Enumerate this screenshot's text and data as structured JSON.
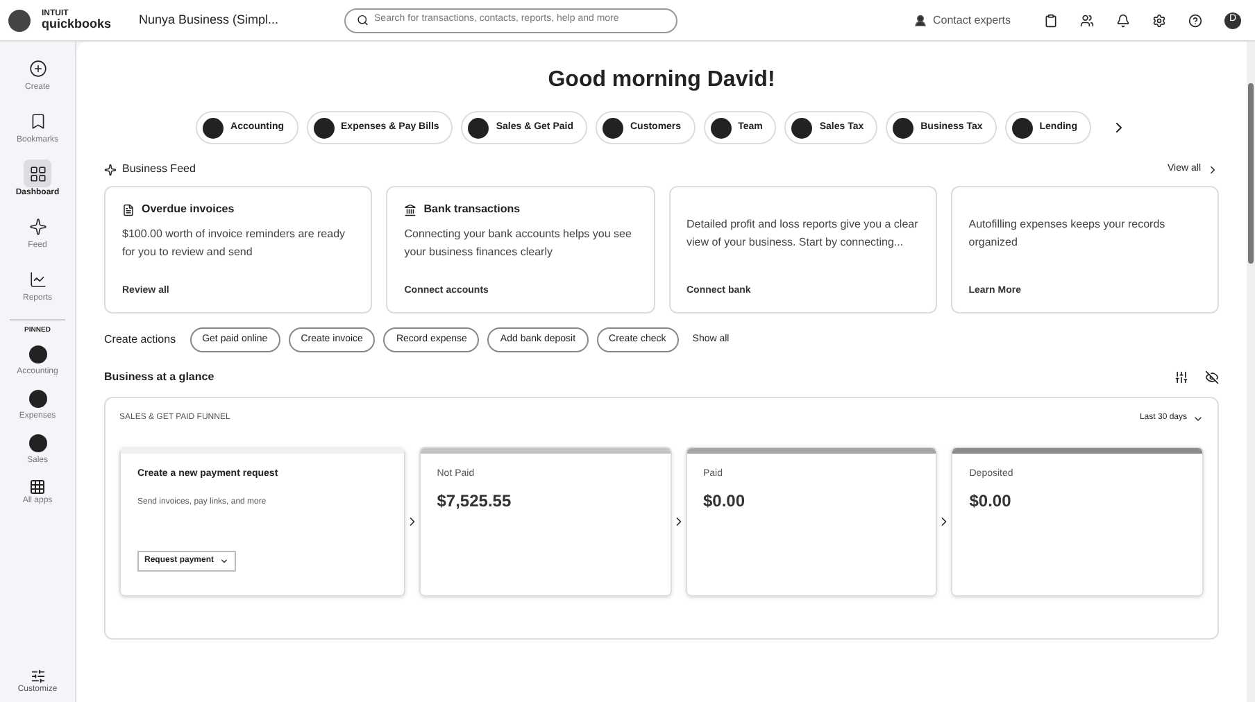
{
  "topbar": {
    "logo_top": "INTUIT",
    "logo_bottom": "quickbooks",
    "company": "Nunya Business (Simpl...",
    "search": {
      "placeholder": "Search for transactions, contacts, reports, help and more"
    },
    "contact": "Contact experts",
    "avatar": "D"
  },
  "sidebar": {
    "items": [
      {
        "label": "Create",
        "selected": false
      },
      {
        "label": "Bookmarks",
        "selected": false
      },
      {
        "label": "Dashboard",
        "selected": true
      },
      {
        "label": "Feed",
        "selected": false
      },
      {
        "label": "Reports",
        "selected": false
      }
    ],
    "section": "PINNED",
    "pinned": [
      {
        "label": "Accounting",
        "selected": false
      },
      {
        "label": "Expenses",
        "selected": false
      },
      {
        "label": "Sales",
        "selected": false
      }
    ],
    "apps": "All apps",
    "customize": "Customize"
  },
  "greeting": "Good morning David!",
  "chips": [
    "Accounting",
    "Expenses & Pay Bills",
    "Sales & Get Paid",
    "Customers",
    "Team",
    "Sales Tax",
    "Business Tax",
    "Lending"
  ],
  "feed": {
    "title": "Business Feed",
    "view_all": "View all",
    "cards": [
      {
        "title": "Overdue invoices",
        "text": "$100.00 worth of invoice reminders are ready for you to review and send",
        "link": "Review all"
      },
      {
        "title": "Bank transactions",
        "text": "Connecting your bank accounts helps you see your business finances clearly",
        "link": "Connect accounts"
      },
      {
        "text": "Detailed profit and loss reports give you a clear view of your business. Start by connecting...",
        "link": "Connect bank"
      },
      {
        "text": "Autofilling expenses keeps your records organized",
        "link": "Learn More"
      }
    ]
  },
  "actions": {
    "label": "Create actions",
    "buttons": [
      "Get paid online",
      "Create invoice",
      "Record expense",
      "Add bank deposit",
      "Create check"
    ],
    "show_all": "Show all"
  },
  "glance": {
    "title": "Business at a glance"
  },
  "funnel": {
    "title": "SALES & GET PAID FUNNEL",
    "range": "Last 30 days",
    "cards": [
      {
        "kind": "create",
        "title": "Create a new payment request",
        "text": "Send invoices, pay links, and more",
        "button": "Request payment"
      },
      {
        "kind": "stage",
        "label": "Not Paid",
        "amount": "$7,525.55",
        "color": "#c4c4c4"
      },
      {
        "kind": "stage",
        "label": "Paid",
        "amount": "$0.00",
        "color": "#a6a6a6"
      },
      {
        "kind": "stage",
        "label": "Deposited",
        "amount": "$0.00",
        "color": "#8c8c8c"
      }
    ]
  }
}
